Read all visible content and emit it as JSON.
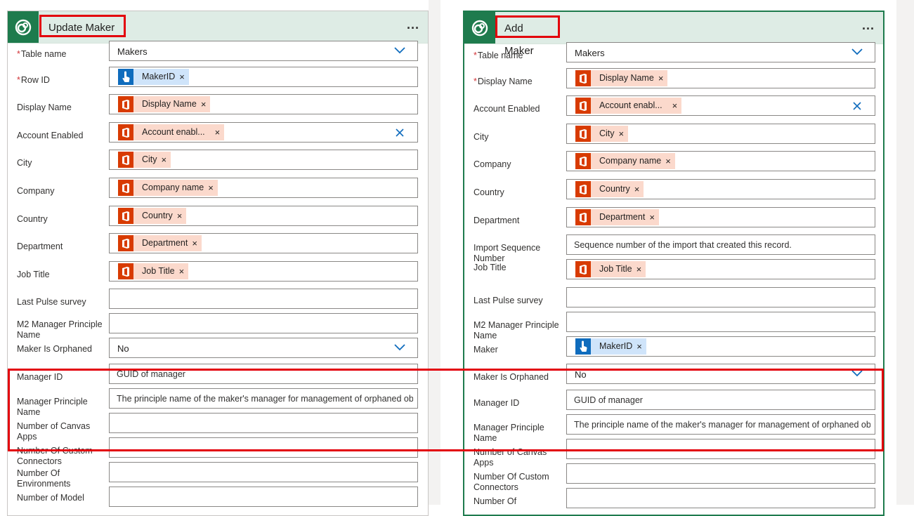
{
  "cards": [
    {
      "title": "Update Maker",
      "more_label": "...",
      "fields": [
        {
          "label": "Table name",
          "required": true,
          "type": "dropdown",
          "value": "Makers"
        },
        {
          "label": "Row ID",
          "required": true,
          "type": "token",
          "token": {
            "kind": "flow",
            "text": "MakerID"
          }
        },
        {
          "label": "Display Name",
          "type": "token",
          "token": {
            "kind": "office",
            "text": "Display Name"
          }
        },
        {
          "label": "Account Enabled",
          "type": "token",
          "token": {
            "kind": "office",
            "text": "Account enabl..."
          },
          "clearable": true
        },
        {
          "label": "City",
          "type": "token",
          "token": {
            "kind": "office",
            "text": "City"
          }
        },
        {
          "label": "Company",
          "type": "token",
          "token": {
            "kind": "office",
            "text": "Company name"
          }
        },
        {
          "label": "Country",
          "type": "token",
          "token": {
            "kind": "office",
            "text": "Country"
          }
        },
        {
          "label": "Department",
          "type": "token",
          "token": {
            "kind": "office",
            "text": "Department"
          }
        },
        {
          "label": "Job Title",
          "type": "token",
          "token": {
            "kind": "office",
            "text": "Job Title"
          }
        },
        {
          "label": "Last Pulse survey",
          "type": "text",
          "placeholder": ""
        },
        {
          "label": "M2 Manager Principle Name",
          "type": "text",
          "placeholder": ""
        },
        {
          "label": "Maker Is Orphaned",
          "type": "dropdown",
          "value": "No"
        },
        {
          "label": "Manager ID",
          "type": "text",
          "placeholder": "GUID of manager"
        },
        {
          "label": "Manager Principle Name",
          "type": "text",
          "placeholder": "The principle name of the maker's manager for management of orphaned objects"
        },
        {
          "label": "Number of Canvas Apps",
          "type": "text",
          "placeholder": ""
        },
        {
          "label": "Number Of Custom Connectors",
          "type": "text",
          "placeholder": ""
        },
        {
          "label": "Number Of Environments",
          "type": "text",
          "placeholder": ""
        },
        {
          "label": "Number of Model",
          "type": "text",
          "placeholder": ""
        }
      ]
    },
    {
      "title": "Add Maker",
      "more_label": "...",
      "fields": [
        {
          "label": "Table name",
          "required": true,
          "type": "dropdown",
          "value": "Makers"
        },
        {
          "label": "Display Name",
          "required": true,
          "type": "token",
          "token": {
            "kind": "office",
            "text": "Display Name"
          }
        },
        {
          "label": "Account Enabled",
          "type": "token",
          "token": {
            "kind": "office",
            "text": "Account enabl..."
          },
          "clearable": true
        },
        {
          "label": "City",
          "type": "token",
          "token": {
            "kind": "office",
            "text": "City"
          }
        },
        {
          "label": "Company",
          "type": "token",
          "token": {
            "kind": "office",
            "text": "Company name"
          }
        },
        {
          "label": "Country",
          "type": "token",
          "token": {
            "kind": "office",
            "text": "Country"
          }
        },
        {
          "label": "Department",
          "type": "token",
          "token": {
            "kind": "office",
            "text": "Department"
          }
        },
        {
          "label": "Import Sequence Number",
          "type": "text",
          "placeholder": "Sequence number of the import that created this record."
        },
        {
          "label": "Job Title",
          "type": "token",
          "token": {
            "kind": "office",
            "text": "Job Title"
          }
        },
        {
          "label": "Last Pulse survey",
          "type": "text",
          "placeholder": ""
        },
        {
          "label": "M2 Manager Principle Name",
          "type": "text",
          "placeholder": ""
        },
        {
          "label": "Maker",
          "type": "token",
          "token": {
            "kind": "flow",
            "text": "MakerID"
          }
        },
        {
          "label": "Maker Is Orphaned",
          "type": "dropdown",
          "value": "No"
        },
        {
          "label": "Manager ID",
          "type": "text",
          "placeholder": "GUID of manager"
        },
        {
          "label": "Manager Principle Name",
          "type": "text",
          "placeholder": "The principle name of the maker's manager for management of orphaned objects"
        },
        {
          "label": "Number of Canvas Apps",
          "type": "text",
          "placeholder": ""
        },
        {
          "label": "Number Of Custom Connectors",
          "type": "text",
          "placeholder": ""
        },
        {
          "label": "Number Of",
          "type": "text",
          "placeholder": ""
        }
      ]
    }
  ],
  "colors": {
    "header_bg": "#deece5",
    "logo_bg": "#1e7b4d",
    "office_token_icon": "#d83b01",
    "office_token_bg": "#fbd9cc",
    "flow_token_icon": "#0f6cbd",
    "flow_token_bg": "#cfe4fa",
    "highlight": "#e3000b"
  }
}
